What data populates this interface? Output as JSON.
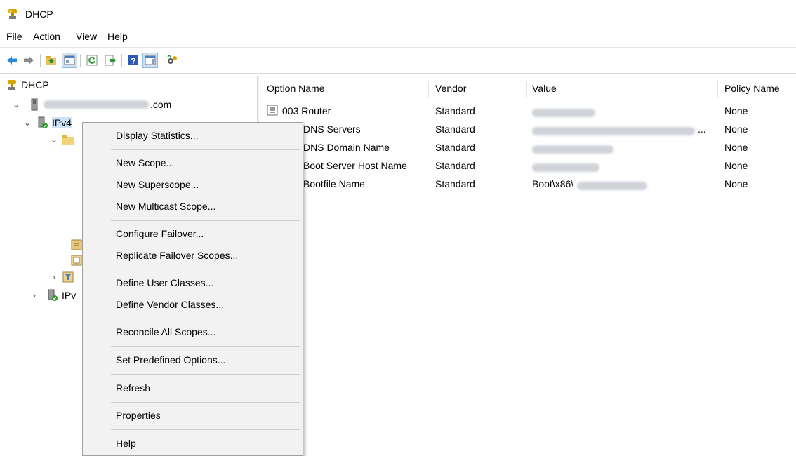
{
  "window": {
    "title": "DHCP"
  },
  "menubar": {
    "items": [
      "File",
      "Action",
      "View",
      "Help"
    ]
  },
  "toolbar": {
    "icons": [
      "back-arrow-icon",
      "forward-arrow-icon",
      "up-folder-icon",
      "show-hide-tree-icon",
      "refresh-icon",
      "export-list-icon",
      "help-icon",
      "action-pane-icon",
      "dhcp-settings-icon"
    ]
  },
  "tree": {
    "root": "DHCP",
    "server_suffix": ".com",
    "ipv4": "IPv4",
    "ipv6": "IPv"
  },
  "list": {
    "columns": [
      "Option Name",
      "Vendor",
      "Value",
      "Policy Name"
    ],
    "rows": [
      {
        "name": "003 Router",
        "vendor": "Standard",
        "value": "",
        "policy": "None"
      },
      {
        "name": "DNS Servers",
        "vendor": "Standard",
        "value": "...",
        "policy": "None"
      },
      {
        "name": "DNS Domain Name",
        "vendor": "Standard",
        "value": "",
        "policy": "None"
      },
      {
        "name": "Boot Server Host Name",
        "vendor": "Standard",
        "value": "",
        "policy": "None"
      },
      {
        "name": "Bootfile Name",
        "vendor": "Standard",
        "value": "Boot\\x86\\",
        "policy": "None"
      }
    ]
  },
  "context_menu": {
    "items": [
      "Display Statistics...",
      "New Scope...",
      "New Superscope...",
      "New Multicast Scope...",
      "Configure Failover...",
      "Replicate Failover Scopes...",
      "Define User Classes...",
      "Define Vendor Classes...",
      "Reconcile All Scopes...",
      "Set Predefined Options...",
      "Refresh",
      "Properties",
      "Help"
    ]
  }
}
